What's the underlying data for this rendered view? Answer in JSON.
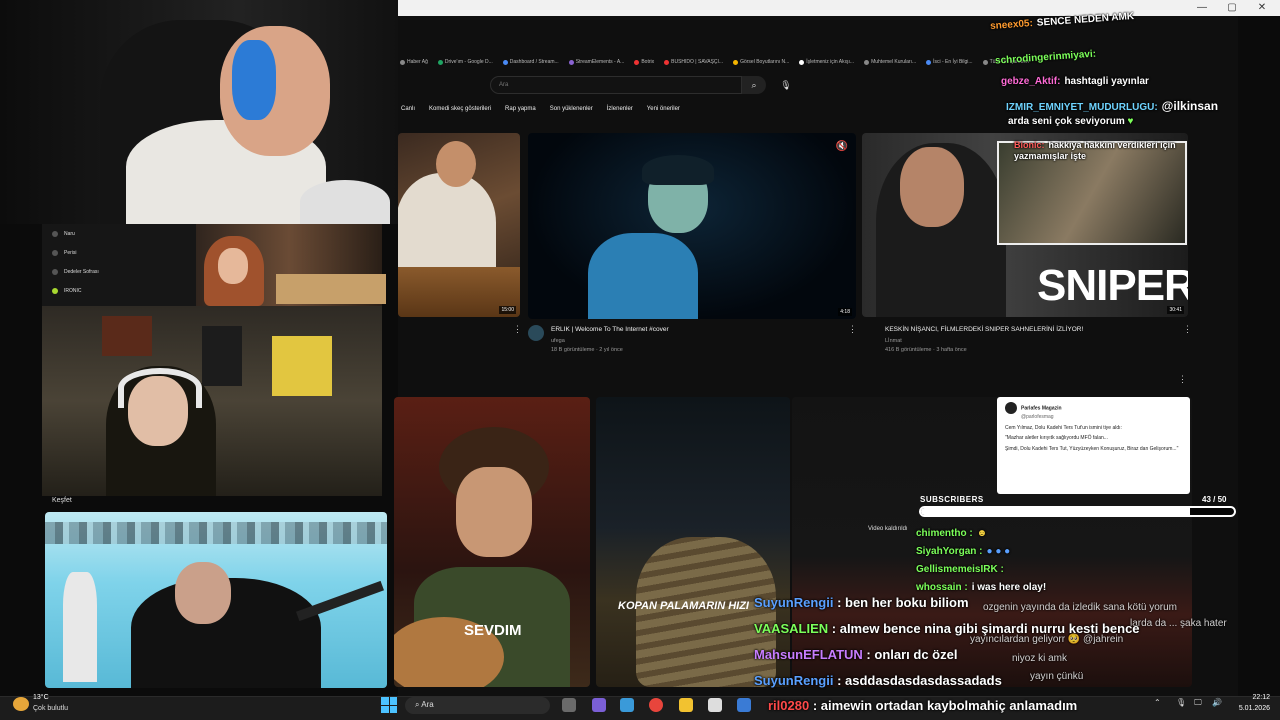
{
  "browser": {
    "bookmarks": [
      "Haber Ağ",
      "Drive'ım - Google D...",
      "Dashboard / Stream...",
      "StreamElements - A...",
      "Botrix",
      "BUSHIDO | SAVAŞÇI...",
      "Görsel Boyutlarını N...",
      "İşletmeniz için Akışı...",
      "Muhtemel Kuruları...",
      "İsci - En İyi Bilgi...",
      "Tüm Yer İşaretleri"
    ],
    "search_placeholder": "Ara",
    "chips": [
      "Canlı",
      "Komedi skeç gösterileri",
      "Rap yapma",
      "Son yüklenenler",
      "İzlenenler",
      "Yeni öneriler"
    ]
  },
  "videos": [
    {
      "title": "ERLIK | Welcome To The Internet #cover",
      "channel": "ufega",
      "meta": "18 B görüntüleme · 2 yıl önce",
      "duration": "4:18"
    },
    {
      "title": "KESKİN NİŞANCI, FİLMLERDEKİ SNIPER SAHNELERİNİ İZLİYOR!",
      "channel": "Lİnmat",
      "meta": "416 B görüntüleme · 3 hafta önce",
      "duration": "30:41",
      "overlay": "SNIPER"
    }
  ],
  "thumb_left_duration": "15:00",
  "shorts": [
    {
      "caption": "SEVDIM"
    },
    {
      "caption": "KOPAN PALAMARIN HIZI"
    }
  ],
  "tweet": {
    "name": "Parlafes Magazin",
    "handle": "@parlofesmag",
    "lines": [
      "Cem Yılmaz, Dolu Kadehi Ters Tut'un ismini tiye aldı:",
      "\"Mazhar aletler kırıyıtk sağlıyordu MFÖ falan...",
      "Şimdi, Dolu Kadehi Ters Tut, Yüzyüzeyken Konuşuruz, Biraz dan Gelişorum...\""
    ]
  },
  "sidebar_items": [
    "Naru",
    "Perisi",
    "Dedeler Sofrası",
    "IRONIC"
  ],
  "kesfet": "Keşfet",
  "chat_top": [
    {
      "user": "sneex05:",
      "text": "SENCE NEDEN AMK",
      "color": "#ffffff",
      "ucolor": "#ff9b2f"
    },
    {
      "user": "schrodingerinmiyavi:",
      "text": "",
      "color": "#ffffff",
      "ucolor": "#7cff5a"
    },
    {
      "user": "gebze_Aktif:",
      "text": "hashtagli yayınlar",
      "color": "#ffffff",
      "ucolor": "#ff6bd6"
    },
    {
      "user": "IZMIR_EMNIYET_MUDURLUGU:",
      "text": "@ilkinsan",
      "color": "#ffffff",
      "ucolor": "#6fd4ff"
    },
    {
      "user": "",
      "text": "arda seni çok seviyorum",
      "color": "#ffffff",
      "ucolor": "#ffffff"
    },
    {
      "user": "Bionic:",
      "text": "hakkıya hakkını verdikleri için yazmamışlar işte",
      "color": "#ffffff",
      "ucolor": "#ff5a5a"
    }
  ],
  "chat_mid": [
    {
      "user": "chimentho :",
      "text": "",
      "ucolor": "#7cff5a"
    },
    {
      "user": "SiyahYorgan :",
      "text": "",
      "ucolor": "#7cff5a"
    },
    {
      "user": "GellismemeisIRK :",
      "text": "",
      "ucolor": "#7cff5a"
    },
    {
      "user": "whossain :",
      "text": "i was here olay!",
      "ucolor": "#7cff5a"
    }
  ],
  "chat_faint": [
    "ozgenin yayında da izledik sana kötü yorum",
    "larda da ... şaka hater",
    "yayıncılardan geliyorr 🥺 @jahrein",
    "niyoz ki amk",
    "yayın çünkü"
  ],
  "chat_main": [
    {
      "user": "SuyunRengii",
      "text": "ben her boku biliom",
      "ucolor": "#5aa0ff"
    },
    {
      "user": "VAASALIEN",
      "text": "aImew bence nina gibi şimardi nurru kesti bence",
      "ucolor": "#7cff5a"
    },
    {
      "user": "MahsunEFLATUN",
      "text": "onları dc özel",
      "ucolor": "#c77dff"
    },
    {
      "user": "SuyunRengii",
      "text": "asddasdasdasdassadads",
      "ucolor": "#5aa0ff"
    },
    {
      "user": "ril0280",
      "text": "aimewin ortadan kaybolmahiç anlamadım",
      "ucolor": "#ff4a4a"
    }
  ],
  "subs": {
    "label": "SUBSCRIBERS",
    "count": "43 / 50",
    "fraction": 0.86
  },
  "video_removed": "Video kaldırıldı",
  "taskbar": {
    "temp": "13°C",
    "weather": "Çok bulutlu",
    "search": "Ara",
    "time": "22:12",
    "date": "5.01.2026"
  }
}
